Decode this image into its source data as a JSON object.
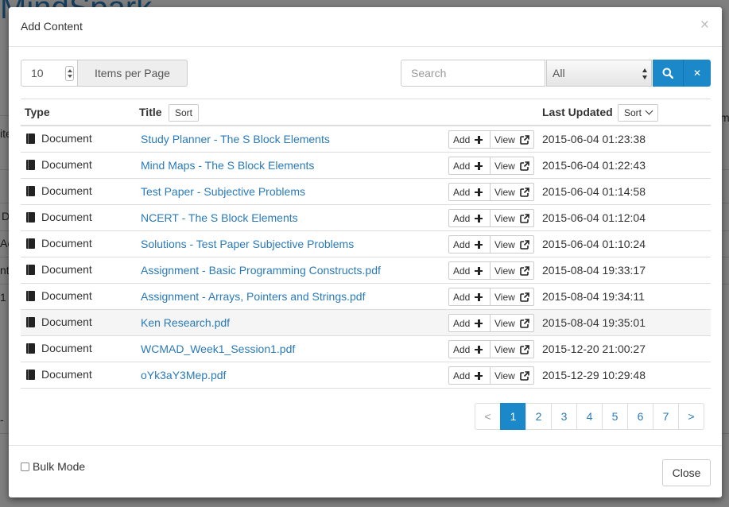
{
  "background": {
    "title_fragment": "MindSpark",
    "fragments": [
      "ite",
      "D",
      "Ac",
      "nt",
      "1",
      "-",
      "m"
    ]
  },
  "modal": {
    "title": "Add Content",
    "close_x": "×"
  },
  "toolbar": {
    "items_per_page_value": "10",
    "items_per_page_label": "Items per Page",
    "search_placeholder": "Search",
    "filter_value": "All"
  },
  "table": {
    "headers": {
      "type": "Type",
      "title": "Title",
      "title_sort": "Sort",
      "last_updated": "Last Updated",
      "date_sort": "Sort"
    },
    "add_label": "Add",
    "view_label": "View",
    "rows": [
      {
        "type": "Document",
        "title": "Study Planner - The S Block Elements",
        "date": "2015-06-04 01:23:38"
      },
      {
        "type": "Document",
        "title": "Mind Maps - The S Block Elements",
        "date": "2015-06-04 01:22:43"
      },
      {
        "type": "Document",
        "title": "Test Paper - Subjective Problems",
        "date": "2015-06-04 01:14:58"
      },
      {
        "type": "Document",
        "title": "NCERT - The S Block Elements",
        "date": "2015-06-04 01:12:04"
      },
      {
        "type": "Document",
        "title": "Solutions - Test Paper Subjective Problems",
        "date": "2015-06-04 01:10:24"
      },
      {
        "type": "Document",
        "title": "Assignment - Basic Programming Constructs.pdf",
        "date": "2015-08-04 19:33:17"
      },
      {
        "type": "Document",
        "title": "Assignment - Arrays, Pointers and Strings.pdf",
        "date": "2015-08-04 19:34:11"
      },
      {
        "type": "Document",
        "title": "Ken Research.pdf",
        "date": "2015-08-04 19:35:01"
      },
      {
        "type": "Document",
        "title": "WCMAD_Week1_Session1.pdf",
        "date": "2015-12-20 21:00:27"
      },
      {
        "type": "Document",
        "title": "oYk3aY3Mep.pdf",
        "date": "2015-12-29 10:29:48"
      }
    ]
  },
  "pagination": {
    "prev": "<",
    "pages": [
      "1",
      "2",
      "3",
      "4",
      "5",
      "6",
      "7"
    ],
    "active": "1",
    "next": ">"
  },
  "footer": {
    "bulk_mode_label": "Bulk Mode",
    "close_label": "Close"
  },
  "colors": {
    "accent": "#1a88c9",
    "link": "#2a7ab8"
  }
}
